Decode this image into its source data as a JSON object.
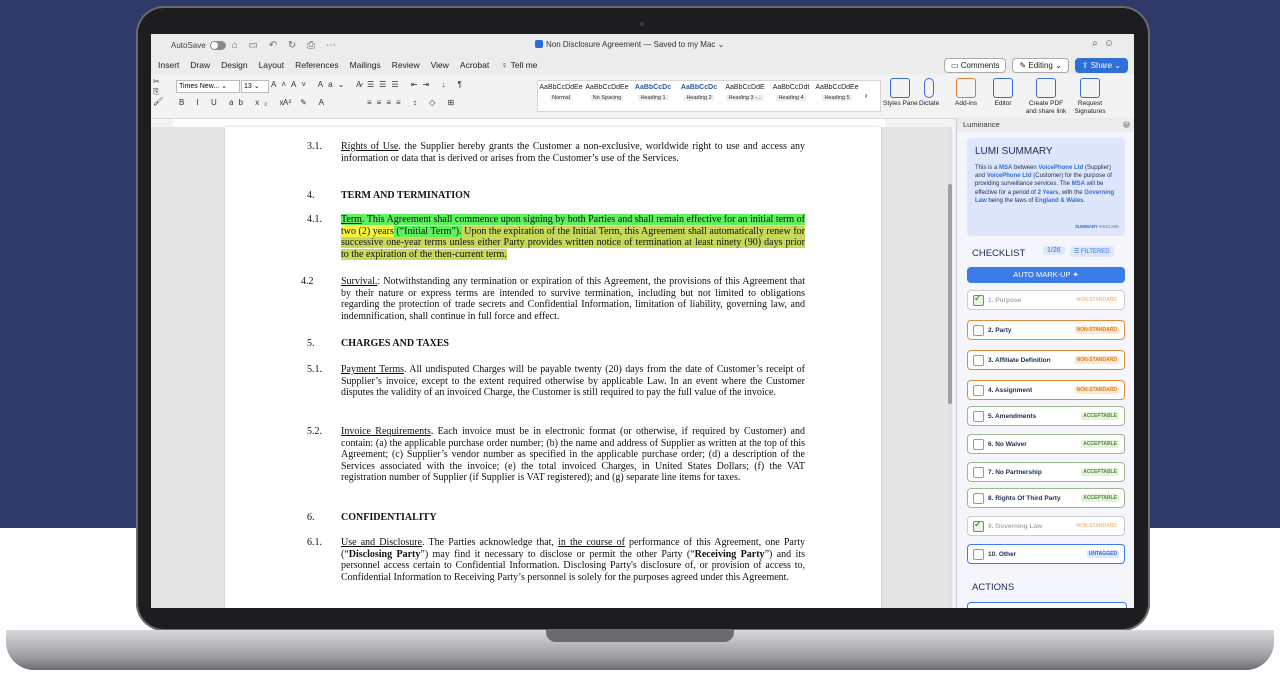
{
  "titlebar": {
    "autosave": "AutoSave",
    "doc_title": "Non Disclosure Agreement — Saved to my Mac ⌄"
  },
  "menu": {
    "items": [
      "Insert",
      "Draw",
      "Design",
      "Layout",
      "References",
      "Mailings",
      "Review",
      "View",
      "Acrobat"
    ],
    "tell_me": "Tell me",
    "comments": "Comments",
    "editing": "Editing ⌄",
    "share": "Share ⌄"
  },
  "ribbon": {
    "font": "Times New...",
    "size": "13",
    "styles": [
      {
        "sample": "AaBbCcDdEe",
        "name": "Normal",
        "heading": false
      },
      {
        "sample": "AaBbCcDdEe",
        "name": "No Spacing",
        "heading": false
      },
      {
        "sample": "AaBbCcDc",
        "name": "Heading 1",
        "heading": true
      },
      {
        "sample": "AaBbCcDc",
        "name": "Heading 2",
        "heading": true
      },
      {
        "sample": "AaBbCcDdE",
        "name": "Heading 3 -...",
        "heading": false
      },
      {
        "sample": "AaBbCcDdt",
        "name": "Heading 4",
        "heading": false
      },
      {
        "sample": "AaBbCcDdEe",
        "name": "Heading 5",
        "heading": false
      }
    ],
    "styles_pane": "Styles Pane",
    "dictate": "Dictate",
    "addins": "Add-ins",
    "editor": "Editor",
    "create_pdf": "Create PDF and share link",
    "request_sig": "Request Signatures"
  },
  "document": {
    "s31_num": "3.1.",
    "s31_title": "Rights of Use",
    "s31_text": ". the Supplier hereby grants the Customer a non-exclusive, worldwide right to use and access any information or data that is derived or arises from the Customer’s use of the Services.",
    "s4_num": "4.",
    "s4_heading": "TERM AND TERMINATION",
    "s41_num": "4.1.",
    "s41_title": "Term",
    "s41_a": ". This Agreement shall commence upon signing by both Parties and shall remain effective for an initial term of ",
    "s41_b": "two (2) years",
    "s41_c": " (“Initial Term”).",
    "s41_d": " Upon the expiration of the Initial Term, this Agreement shall automatically renew for successive one-year terms unless either Party provides written notice of termination at least ninety (90) days prior to the expiration of the then-current term.",
    "s42_num": "4.2",
    "s42_title": "Survival.",
    "s42_text": ": Notwithstanding any termination or expiration of this Agreement, the provisions of this Agreement that by their nature or express terms are intended to survive termination, including but not limited to obligations regarding the protection of trade secrets and Confidential Information, limitation of liability, governing law, and indemnification, shall continue in full force and effect.",
    "s5_num": "5.",
    "s5_heading": "CHARGES AND TAXES",
    "s51_num": "5.1.",
    "s51_title": "Payment Terms",
    "s51_text": ". All undisputed Charges will be payable twenty (20) days from the date of Customer’s receipt of Supplier’s invoice, except to the extent required otherwise by applicable Law. In an event where the Customer disputes the validity of an invoiced Charge, the Customer is still required to pay the full value of the invoice.",
    "s52_num": "5.2.",
    "s52_title": "Invoice Requirements",
    "s52_text": ". Each invoice must be in electronic format (or otherwise, if required by Customer) and contain: (a) the applicable purchase order number; (b) the name and address of Supplier as written at the top of this Agreement; (c) Supplier’s vendor number as specified in the applicable purchase order; (d) a description of the Services associated with the invoice; (e) the total invoiced Charges, in United States Dollars; (f) the VAT registration number of Supplier (if Supplier is VAT registered); and (g) separate line items for taxes.",
    "s6_num": "6.",
    "s6_heading": "CONFIDENTIALITY",
    "s61_num": "6.1.",
    "s61_title": "Use and Disclosure",
    "s61_a": ". The Parties acknowledge that, ",
    "s61_b": "in the course of",
    "s61_c": " performance of this Agreement, one Party (“",
    "s61_d": "Disclosing Party",
    "s61_e": "”) may find it necessary to disclose or permit the other Party (“",
    "s61_f": "Receiving Party",
    "s61_g": "”) and its personnel access certain to Confidential Information. Disclosing Party's disclosure of, or provision of access to, Confidential Information to Receiving Party’s personnel is solely for the purposes agreed under this Agreement."
  },
  "panel": {
    "header": "Luminance",
    "summary_title": "LUMI SUMMARY",
    "summary": {
      "t1": "This is a ",
      "msa1": "MSA",
      "t2": " between ",
      "party1": "VoicePhone Ltd",
      "t3": " (Supplier) and ",
      "party2": "VoicePhone Ltd",
      "t4": " (Customer) for the purpose of providing surveillance services. The ",
      "msa2": "MSA",
      "t5": " will be effective for a period of ",
      "period": "2 Years",
      "t6": ", with the ",
      "law": "Governing Law",
      "t7": " being the laws of ",
      "place": "England & Wales",
      "t8": "."
    },
    "summary_tab": "SUMMARY",
    "redline_tab": "REDLINE",
    "checklist_title": "CHECKLIST",
    "checklist_count": "1/26",
    "filtered": "FILTERED",
    "automark": "AUTO MARK-UP",
    "items": [
      {
        "label": "1. Purpose",
        "tag": "NON-STANDARD"
      },
      {
        "label": "2. Party",
        "tag": "NON-STANDARD"
      },
      {
        "label": "3. Affiliate Definition",
        "tag": "NON-STANDARD"
      },
      {
        "label": "4. Assignment",
        "tag": "NON-STANDARD"
      },
      {
        "label": "5. Amendments",
        "tag": "ACCEPTABLE"
      },
      {
        "label": "6. No Waiver",
        "tag": "ACCEPTABLE"
      },
      {
        "label": "7. No Partnership",
        "tag": "ACCEPTABLE"
      },
      {
        "label": "8. Rights Of Third Party",
        "tag": "ACCEPTABLE"
      },
      {
        "label": "9. Governing Law",
        "tag": "NON-STANDARD"
      },
      {
        "label": "10. Other",
        "tag": "UNTAGGED"
      }
    ],
    "actions_title": "ACTIONS"
  }
}
